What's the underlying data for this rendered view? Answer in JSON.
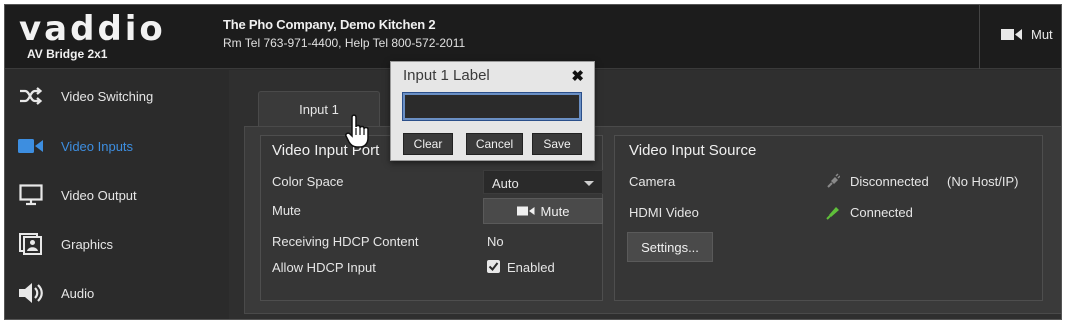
{
  "header": {
    "logo": "vaddio",
    "product": "AV Bridge 2x1",
    "company": "The Pho Company, Demo Kitchen 2",
    "contact": "Rm Tel 763-971-4400, Help Tel 800-572-2011",
    "mute_label": "Mut"
  },
  "sidebar": {
    "items": [
      {
        "label": "Video Switching",
        "icon": "shuffle-icon",
        "active": false
      },
      {
        "label": "Video Inputs",
        "icon": "video-camera-icon",
        "active": true
      },
      {
        "label": "Video Output",
        "icon": "monitor-icon",
        "active": false
      },
      {
        "label": "Graphics",
        "icon": "graphics-icon",
        "active": false
      },
      {
        "label": "Audio",
        "icon": "speaker-icon",
        "active": false
      }
    ]
  },
  "main": {
    "tab_label": "Input 1",
    "video_input_port": {
      "title": "Video Input Port",
      "color_space_label": "Color Space",
      "color_space_value": "Auto",
      "mute_label": "Mute",
      "mute_button": "Mute",
      "hdcp_receiving_label": "Receiving HDCP Content",
      "hdcp_receiving_value": "No",
      "allow_hdcp_label": "Allow HDCP Input",
      "allow_hdcp_value": "Enabled",
      "allow_hdcp_checked": true
    },
    "video_input_source": {
      "title": "Video Input Source",
      "camera_label": "Camera",
      "camera_status": "Disconnected",
      "camera_note": "(No Host/IP)",
      "hdmi_label": "HDMI Video",
      "hdmi_status": "Connected",
      "settings_button": "Settings..."
    }
  },
  "popup": {
    "title": "Input 1 Label",
    "input_value": "",
    "clear": "Clear",
    "cancel": "Cancel",
    "save": "Save"
  },
  "colors": {
    "active_nav": "#3d8ee0",
    "connected": "#5fbf3a",
    "disconnected": "#888888"
  }
}
